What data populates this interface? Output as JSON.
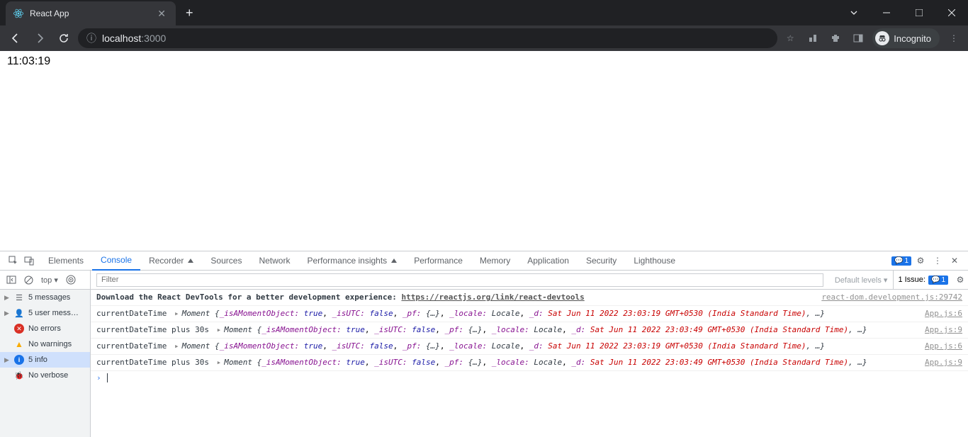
{
  "tab": {
    "title": "React App"
  },
  "url": {
    "host": "localhost",
    "port": ":3000"
  },
  "incognito_label": "Incognito",
  "page_text": "11:03:19",
  "devtools": {
    "tabs": [
      "Elements",
      "Console",
      "Recorder",
      "Sources",
      "Network",
      "Performance insights",
      "Performance",
      "Memory",
      "Application",
      "Security",
      "Lighthouse"
    ],
    "active_tab": "Console",
    "warn_count": "1",
    "context": "top",
    "filter_placeholder": "Filter",
    "levels": "Default levels",
    "issue_label": "1 Issue:",
    "issue_count": "1"
  },
  "sidebar": {
    "messages": "5 messages",
    "user": "5 user mess…",
    "errors": "No errors",
    "warnings": "No warnings",
    "info": "5 info",
    "verbose": "No verbose"
  },
  "console": {
    "banner_text": "Download the React DevTools for a better development experience: ",
    "banner_link": "https://reactjs.org/link/react-devtools",
    "banner_src": "react-dom.development.js:29742",
    "rows": [
      {
        "label": "currentDateTime",
        "date": "Sat Jun 11 2022 23:03:19 GMT+0530 (India Standard Time)",
        "src": "App.js:6"
      },
      {
        "label": "currentDateTime plus 30s",
        "date": "Sat Jun 11 2022 23:03:49 GMT+0530 (India Standard Time)",
        "src": "App.js:9"
      },
      {
        "label": "currentDateTime",
        "date": "Sat Jun 11 2022 23:03:19 GMT+0530 (India Standard Time)",
        "src": "App.js:6"
      },
      {
        "label": "currentDateTime plus 30s",
        "date": "Sat Jun 11 2022 23:03:49 GMT+0530 (India Standard Time)",
        "src": "App.js:9"
      }
    ],
    "moment_prefix": "Moment {",
    "moment_p1": "_isAMomentObject:",
    "moment_v1": "true",
    "moment_p2": "_isUTC:",
    "moment_v2": "false",
    "moment_p3": "_pf:",
    "moment_v3": "{…}",
    "moment_p4": "_locale:",
    "moment_v4": "Locale",
    "moment_p5": "_d:",
    "moment_suffix": ", …}"
  }
}
